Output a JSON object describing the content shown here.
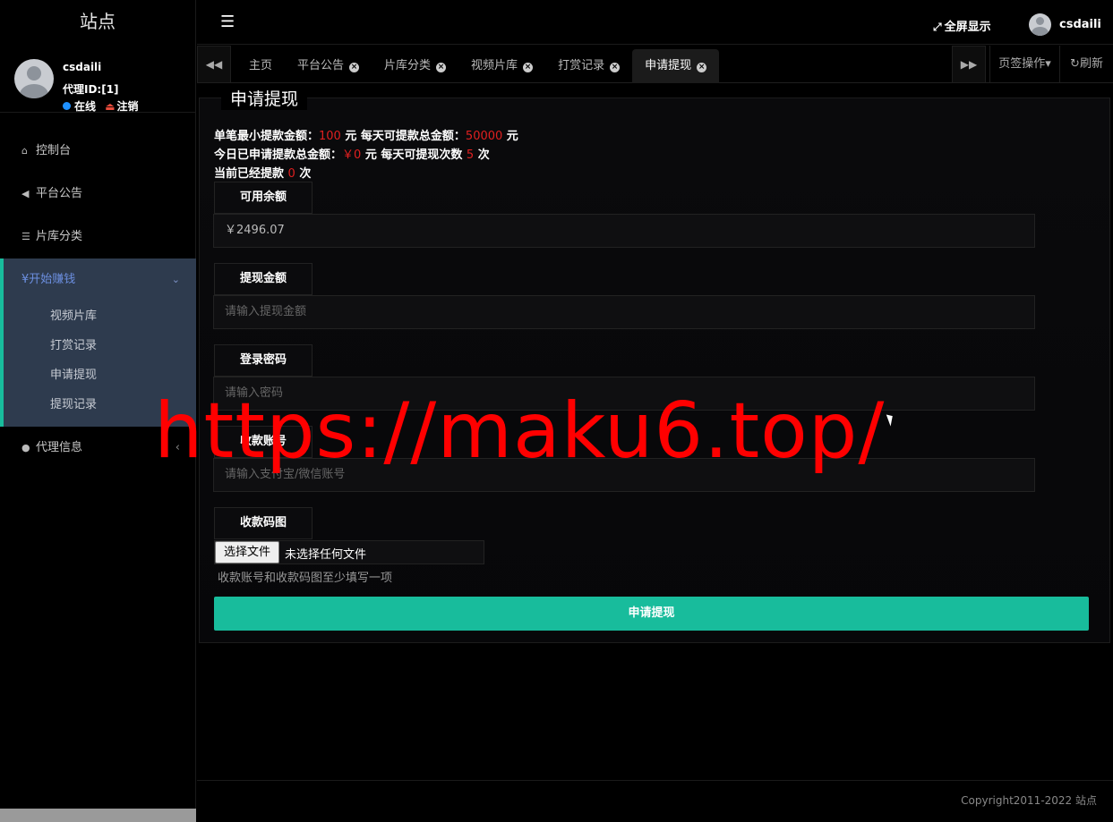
{
  "sidebar": {
    "site_title": "站点",
    "user": {
      "name": "csdaili",
      "agent_id": "代理ID:[1]",
      "status": "在线",
      "logout": "注销"
    },
    "menu": [
      {
        "label": "控制台",
        "icon": "home-icon"
      },
      {
        "label": "平台公告",
        "icon": "bullhorn-icon"
      },
      {
        "label": "片库分类",
        "icon": "list-icon"
      }
    ],
    "group": {
      "label": "¥开始赚钱",
      "items": [
        "视频片库",
        "打赏记录",
        "申请提现",
        "提现记录"
      ]
    },
    "agent_info": "代理信息"
  },
  "header": {
    "fullscreen": "全屏显示",
    "username": "csdaili"
  },
  "tabs": {
    "items": [
      {
        "label": "主页",
        "closable": false
      },
      {
        "label": "平台公告",
        "closable": true
      },
      {
        "label": "片库分类",
        "closable": true
      },
      {
        "label": "视频片库",
        "closable": true
      },
      {
        "label": "打赏记录",
        "closable": true
      },
      {
        "label": "申请提现",
        "closable": true,
        "active": true
      }
    ],
    "ops": "页签操作",
    "refresh": "刷新"
  },
  "form": {
    "legend": "申请提现",
    "info": {
      "min_label": "单笔最小提款金额：",
      "min_value": "100",
      "min_unit": " 元 ",
      "daily_total_label": "每天可提款总金额：",
      "daily_total_value": "50000",
      "daily_total_unit": " 元",
      "today_label": "今日已申请提款总金额：",
      "today_value": "￥0",
      "today_unit": " 元 ",
      "times_label": "每天可提现次数",
      "times_value": "5",
      "times_unit": " 次",
      "current_label": "当前已经提款",
      "current_value": "0",
      "current_unit": " 次"
    },
    "balance_label": "可用余额",
    "balance_value": "￥2496.07",
    "amount_label": "提现金额",
    "amount_placeholder": "请输入提现金额",
    "password_label": "登录密码",
    "password_placeholder": "请输入密码",
    "account_label": "收款账号",
    "account_placeholder": "请输入支付宝/微信账号",
    "qrcode_label": "收款码图",
    "file_button": "选择文件",
    "file_none": "未选择任何文件",
    "hint": "收款账号和收款码图至少填写一项",
    "submit": "申请提现"
  },
  "footer": {
    "copyright": "Copyright2011-2022 站点"
  },
  "watermark": "https://maku6.top/",
  "colors": {
    "accent": "#18bc9c",
    "menu_active_bg": "#2e3b4e",
    "highlight_red": "#e02020"
  }
}
